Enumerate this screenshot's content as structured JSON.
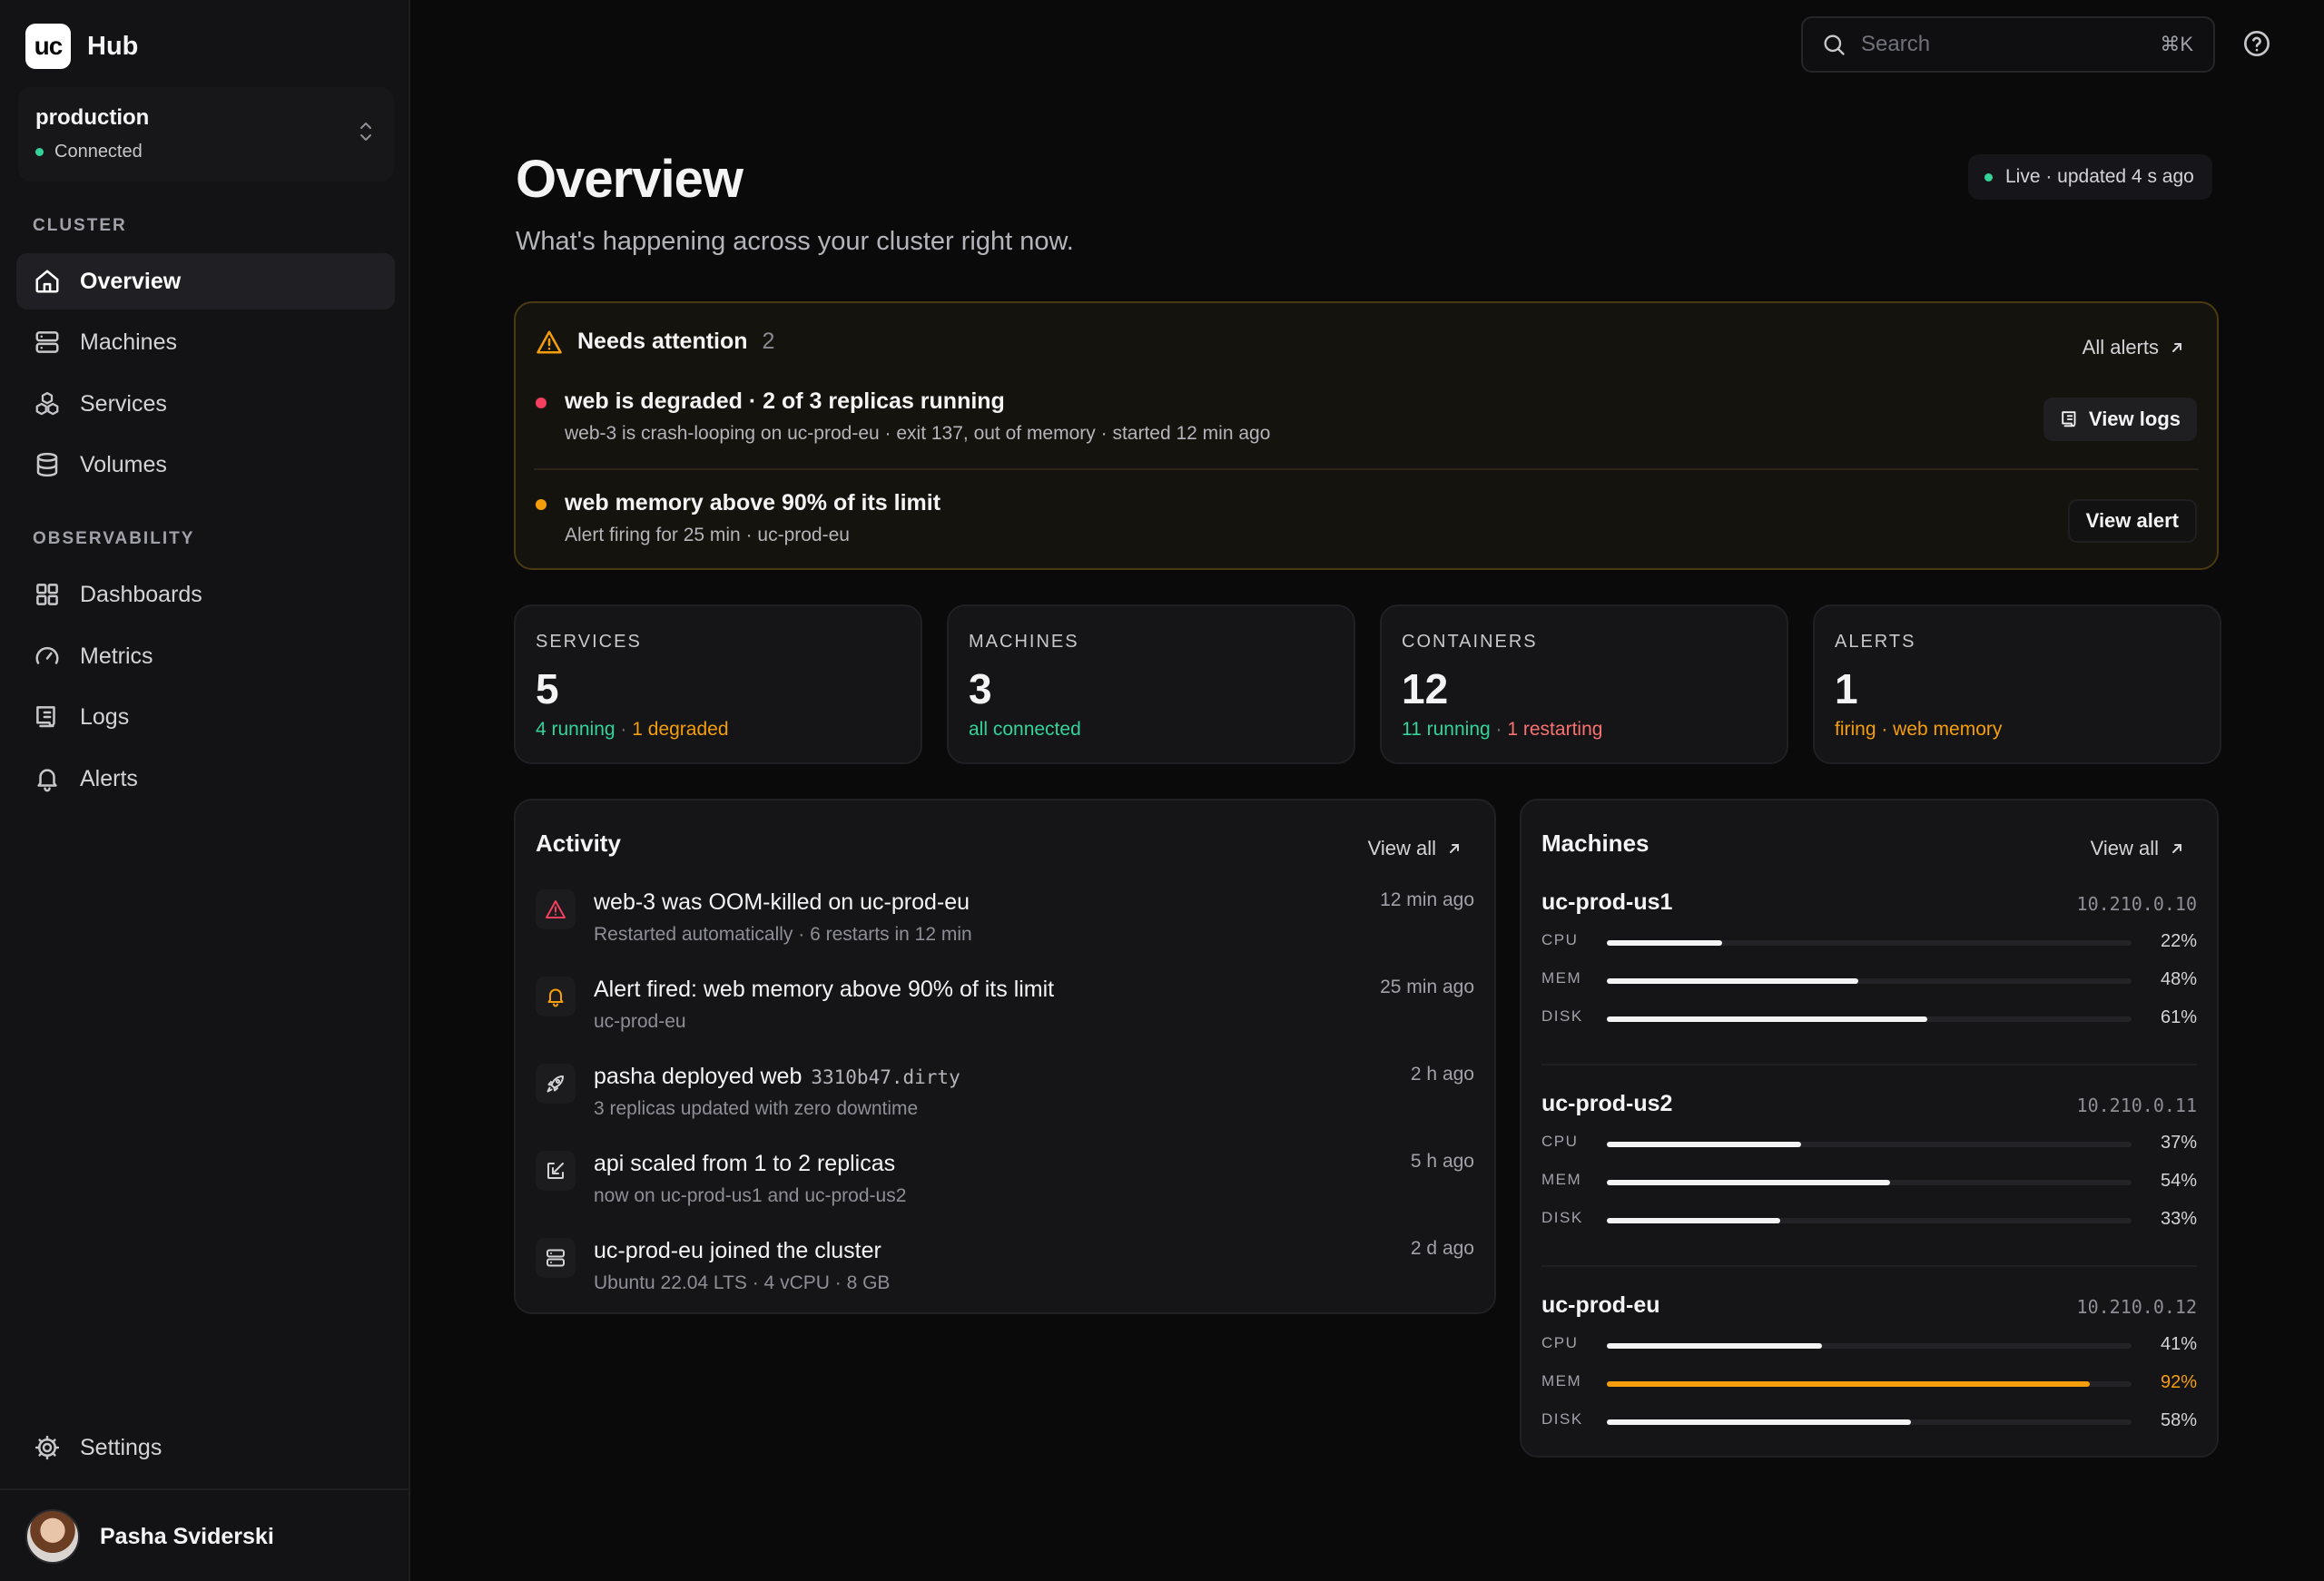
{
  "sidebar": {
    "brand": {
      "logo": "uc",
      "name": "Hub"
    },
    "environment": {
      "name": "production",
      "status": "Connected"
    },
    "sections": {
      "cluster": "CLUSTER",
      "observability": "OBSERVABILITY"
    },
    "nav": {
      "overview": "Overview",
      "machines": "Machines",
      "services": "Services",
      "volumes": "Volumes",
      "dashboards": "Dashboards",
      "metrics": "Metrics",
      "logs": "Logs",
      "alerts": "Alerts",
      "settings": "Settings"
    },
    "user": {
      "name": "Pasha Sviderski"
    }
  },
  "topbar": {
    "search_placeholder": "Search",
    "search_shortcut": "⌘K"
  },
  "header": {
    "title": "Overview",
    "subtitle": "What's happening across your cluster right now.",
    "live_status": "Live · updated 4 s ago"
  },
  "attention": {
    "title": "Needs attention",
    "count": "2",
    "all_alerts": "All alerts",
    "items": [
      {
        "title": "web is degraded · 2 of 3 replicas running",
        "subtitle": "web-3 is crash-looping on uc-prod-eu · exit 137, out of memory · started 12 min ago",
        "action": "View logs",
        "severity_color": "#f43f5e"
      },
      {
        "title": "web memory above 90% of its limit",
        "subtitle": "Alert firing for 25 min · uc-prod-eu",
        "action": "View alert",
        "severity_color": "#f59e0b"
      }
    ]
  },
  "stats": {
    "services": {
      "label": "SERVICES",
      "value": "5",
      "primary": "4 running",
      "sep": " · ",
      "secondary": "1 degraded"
    },
    "machines": {
      "label": "MACHINES",
      "value": "3",
      "primary": "all connected"
    },
    "containers": {
      "label": "CONTAINERS",
      "value": "12",
      "primary": "11 running",
      "sep": " · ",
      "secondary": "1 restarting"
    },
    "alerts": {
      "label": "ALERTS",
      "value": "1",
      "primary": "firing · web memory"
    }
  },
  "activity": {
    "title": "Activity",
    "view_all": "View all",
    "items": [
      {
        "icon": "warning-icon",
        "title": "web-3 was OOM-killed on uc-prod-eu",
        "subtitle": "Restarted automatically · 6 restarts in 12 min",
        "time": "12 min ago"
      },
      {
        "icon": "bell-icon",
        "title": "Alert fired: web memory above 90% of its limit",
        "subtitle": "uc-prod-eu",
        "time": "25 min ago"
      },
      {
        "icon": "rocket-icon",
        "title": "pasha deployed web",
        "tag": "3310b47.dirty",
        "subtitle": "3 replicas updated with zero downtime",
        "time": "2 h ago"
      },
      {
        "icon": "scale-icon",
        "title": "api scaled from 1 to 2 replicas",
        "subtitle": "now on uc-prod-us1 and uc-prod-us2",
        "time": "5 h ago"
      },
      {
        "icon": "server-icon",
        "title": "uc-prod-eu joined the cluster",
        "subtitle": "Ubuntu 22.04 LTS · 4 vCPU · 8 GB",
        "time": "2 d ago"
      }
    ]
  },
  "machines": {
    "title": "Machines",
    "view_all": "View all",
    "metric_labels": {
      "cpu": "CPU",
      "mem": "MEM",
      "disk": "DISK"
    },
    "items": [
      {
        "name": "uc-prod-us1",
        "ip": "10.210.0.10",
        "cpu": 22,
        "mem": 48,
        "disk": 61,
        "cpu_text": "22%",
        "mem_text": "48%",
        "disk_text": "61%"
      },
      {
        "name": "uc-prod-us2",
        "ip": "10.210.0.11",
        "cpu": 37,
        "mem": 54,
        "disk": 33,
        "cpu_text": "37%",
        "mem_text": "54%",
        "disk_text": "33%"
      },
      {
        "name": "uc-prod-eu",
        "ip": "10.210.0.12",
        "cpu": 41,
        "mem": 92,
        "disk": 58,
        "cpu_text": "41%",
        "mem_text": "92%",
        "disk_text": "58%"
      }
    ]
  },
  "colors": {
    "accent_green": "#34d399",
    "warning": "#f59e0b",
    "danger": "#f43f5e"
  }
}
